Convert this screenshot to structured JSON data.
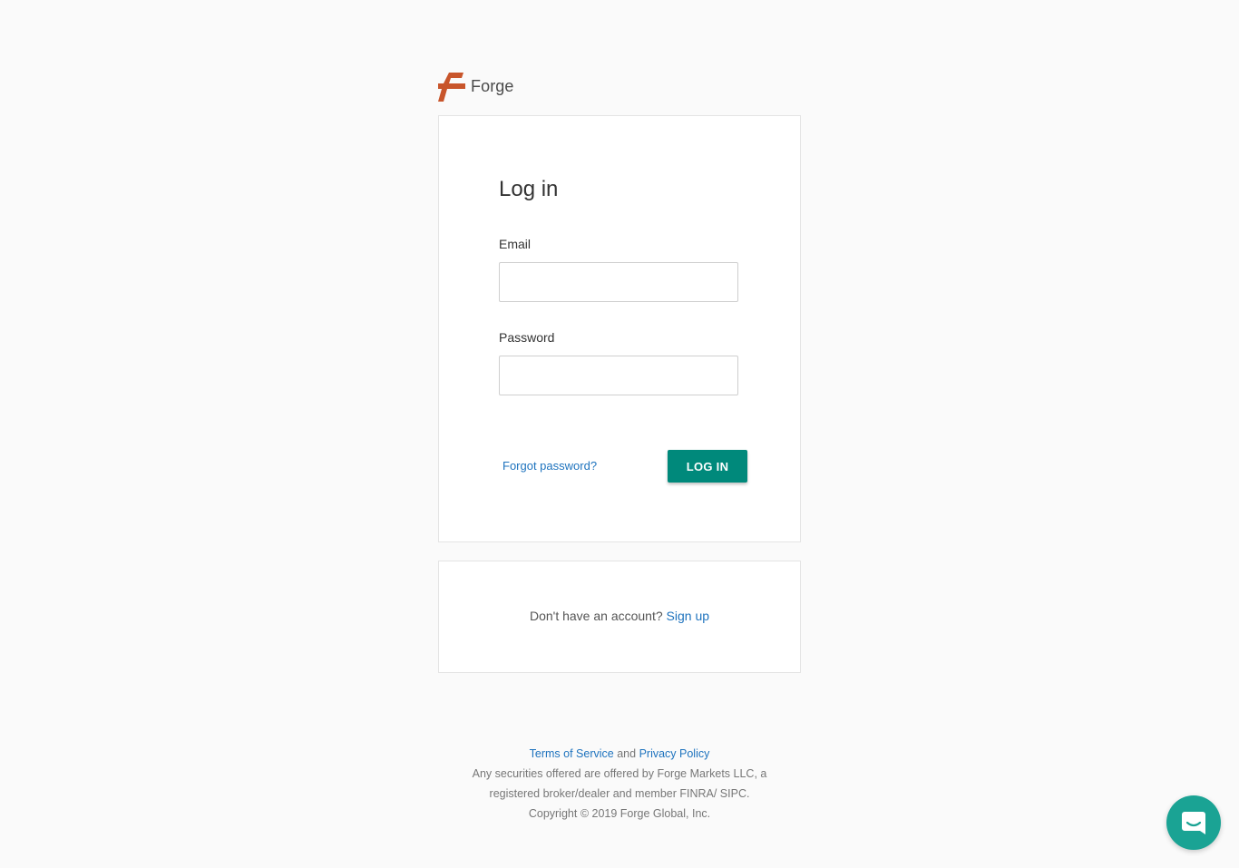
{
  "brand": {
    "name": "Forge",
    "accent": "#c8552b"
  },
  "login": {
    "title": "Log in",
    "email_label": "Email",
    "email_value": "",
    "email_placeholder": "",
    "password_label": "Password",
    "password_value": "",
    "password_placeholder": "",
    "forgot_label": "Forgot password?",
    "submit_label": "LOG IN",
    "button_color": "#00897b"
  },
  "signup": {
    "prompt": "Don't have an account?",
    "link_label": "Sign up"
  },
  "footer": {
    "terms_label": "Terms of Service",
    "and_text": "and",
    "privacy_label": "Privacy Policy",
    "disclaimer_line1": "Any securities offered are offered by Forge Markets LLC, a",
    "disclaimer_line2": "registered broker/dealer and member FINRA/ SIPC.",
    "copyright": "Copyright © 2019 Forge Global, Inc."
  },
  "chat_widget": {
    "icon": "chat-bubble-icon",
    "color": "#1aa394"
  },
  "link_color": "#1e73be"
}
